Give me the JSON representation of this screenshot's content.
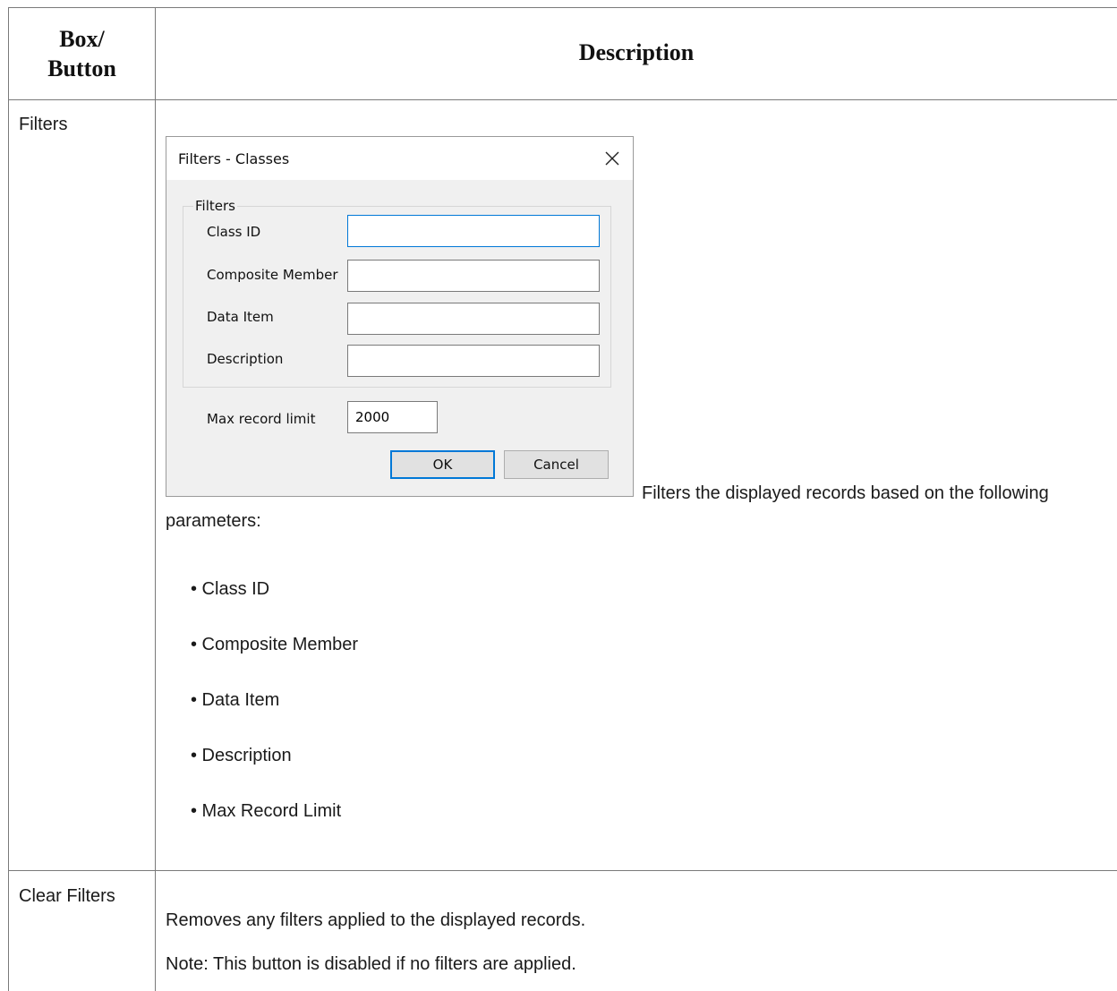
{
  "table": {
    "headers": {
      "col1": "Box/\nButton",
      "col1_line1": "Box/",
      "col1_line2": "Button",
      "col2": "Description"
    },
    "rows": [
      {
        "name": "Filters",
        "lead_text": "Filters the displayed records based on the following",
        "lead_text_cont": "parameters:",
        "bullets": [
          "• Class ID",
          "• Composite Member",
          "• Data Item",
          "• Description",
          "• Max Record Limit"
        ]
      },
      {
        "name": "Clear Filters",
        "description": "Removes any filters applied to the displayed records.",
        "note": "Note: This button is disabled if no filters are applied."
      }
    ]
  },
  "dialog": {
    "title": "Filters - Classes",
    "close_icon": "close-icon",
    "group_label": "Filters",
    "fields": [
      {
        "label": "Class ID",
        "value": ""
      },
      {
        "label": "Composite Member",
        "value": ""
      },
      {
        "label": "Data Item",
        "value": ""
      },
      {
        "label": "Description",
        "value": ""
      }
    ],
    "max_record": {
      "label": "Max record limit",
      "value": "2000"
    },
    "ok_label": "OK",
    "cancel_label": "Cancel",
    "colors": {
      "focus_border": "#0078d7",
      "dialog_bg": "#f0f0f0"
    }
  }
}
